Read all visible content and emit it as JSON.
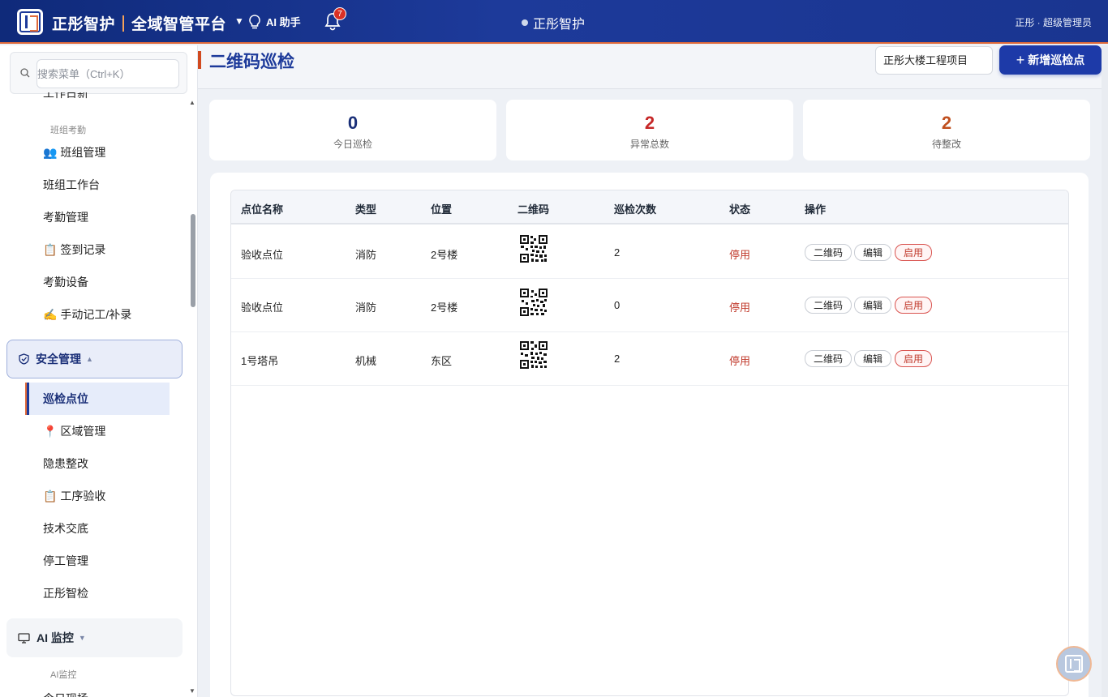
{
  "header": {
    "brand_name": "正彤智护",
    "platform_name": "全域智管平台",
    "ai_helper_label": "AI 助手",
    "notification_count": "7",
    "center_title": "正彤智护",
    "user": "正彤 · 超级管理员"
  },
  "sidebar": {
    "search_placeholder": "搜索菜单（Ctrl+K）",
    "cut_top_item": "工作日新",
    "group_label_team": "班组考勤",
    "items_team": [
      {
        "icon": "👥",
        "label": "班组管理"
      },
      {
        "icon": "",
        "label": "班组工作台"
      },
      {
        "icon": "",
        "label": "考勤管理"
      },
      {
        "icon": "📋",
        "label": "签到记录"
      },
      {
        "icon": "",
        "label": "考勤设备"
      },
      {
        "icon": "✍️",
        "label": "手动记工/补录"
      }
    ],
    "section_safety": "安全管理",
    "items_safety": [
      {
        "icon": "",
        "label": "巡检点位",
        "active": true
      },
      {
        "icon": "📍",
        "label": "区域管理"
      },
      {
        "icon": "",
        "label": "隐患整改"
      },
      {
        "icon": "📋",
        "label": "工序验收"
      },
      {
        "icon": "",
        "label": "技术交底"
      },
      {
        "icon": "",
        "label": "停工管理"
      },
      {
        "icon": "",
        "label": "正彤智检"
      }
    ],
    "section_ai": "AI 监控",
    "group_label_ai": "AI监控",
    "cut_bottom_item": "今日现场"
  },
  "main": {
    "page_title": "二维码巡检",
    "project_select": "正彤大楼工程项目",
    "add_button": "新增巡检点",
    "stats": [
      {
        "value": "0",
        "label": "今日巡检",
        "color": "#1a2f78"
      },
      {
        "value": "2",
        "label": "异常总数",
        "color": "#c62828"
      },
      {
        "value": "2",
        "label": "待整改",
        "color": "#c0501f"
      }
    ],
    "table": {
      "columns": [
        "点位名称",
        "类型",
        "位置",
        "二维码",
        "巡检次数",
        "状态",
        "操作"
      ],
      "rows": [
        {
          "name": "验收点位",
          "type": "消防",
          "location": "2号楼",
          "count": "2",
          "status": "停用"
        },
        {
          "name": "验收点位",
          "type": "消防",
          "location": "2号楼",
          "count": "0",
          "status": "停用"
        },
        {
          "name": "1号塔吊",
          "type": "机械",
          "location": "东区",
          "count": "2",
          "status": "停用"
        }
      ],
      "actions": {
        "qr": "二维码",
        "edit": "编辑",
        "enable": "启用"
      }
    }
  }
}
